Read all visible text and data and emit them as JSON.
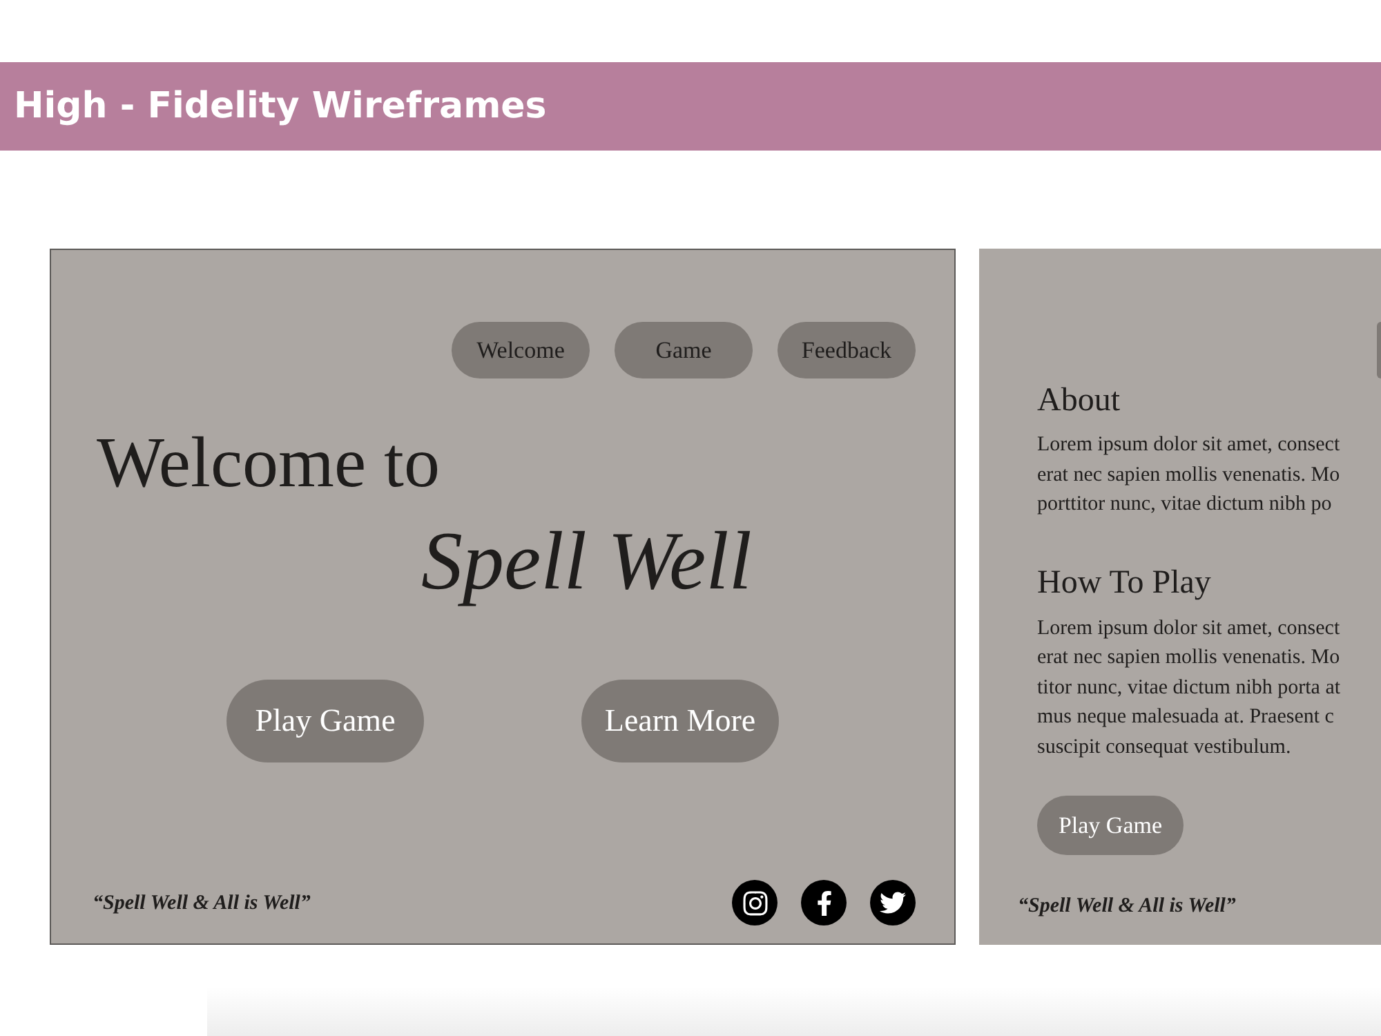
{
  "header": {
    "title": "High - Fidelity Wireframes"
  },
  "home_screen": {
    "nav": [
      {
        "label": "Welcome"
      },
      {
        "label": "Game"
      },
      {
        "label": "Feedback"
      }
    ],
    "greeting": "Welcome to",
    "app_name": "Spell Well",
    "buttons": [
      {
        "label": "Play Game"
      },
      {
        "label": "Learn More"
      }
    ],
    "tagline": "“Spell Well & All is Well”",
    "social_links": [
      {
        "kind": "camera"
      },
      {
        "kind": "letter_f"
      },
      {
        "kind": "bird"
      }
    ]
  },
  "info_screen": {
    "sections": [
      {
        "heading": "About",
        "lines": [
          "Lorem ipsum dolor sit amet, consect",
          "erat nec sapien mollis venenatis. Mo",
          "porttitor nunc, vitae dictum nibh po"
        ]
      },
      {
        "heading": "How To Play",
        "lines": [
          "Lorem ipsum dolor sit amet, consect",
          "erat nec sapien mollis venenatis. Mo",
          "titor nunc, vitae dictum nibh porta at",
          "mus neque malesuada at. Praesent c",
          "suscipit consequat vestibulum."
        ]
      }
    ],
    "button": "Play Game",
    "tagline": "“Spell Well & All is Well”"
  }
}
